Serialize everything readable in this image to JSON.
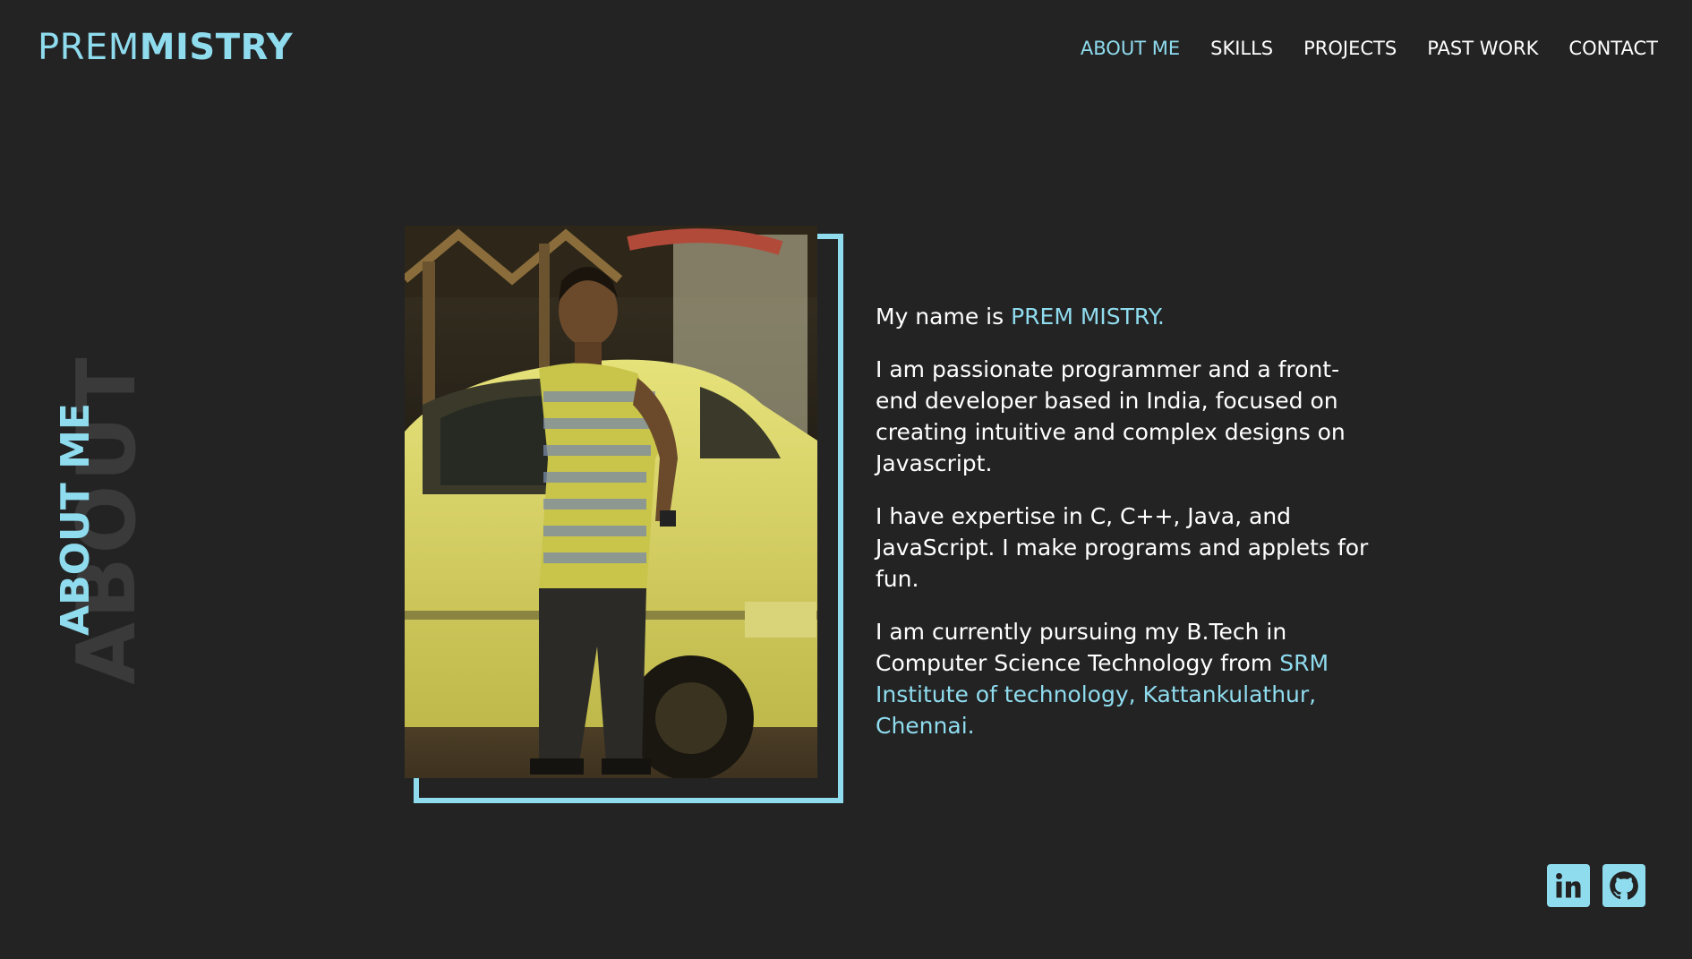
{
  "logo": {
    "first": "PREM",
    "last": "MISTRY"
  },
  "nav": {
    "items": [
      {
        "label": "ABOUT ME",
        "active": true
      },
      {
        "label": "SKILLS"
      },
      {
        "label": "PROJECTS"
      },
      {
        "label": "PAST WORK"
      },
      {
        "label": "CONTACT"
      }
    ]
  },
  "section": {
    "title_bg": "ABOUT",
    "title_fg": "ABOUT ME"
  },
  "about": {
    "name_prefix": "My name is ",
    "name": "PREM MISTRY.",
    "p2": "I am passionate programmer and a front-end developer based in India, focused on creating intuitive and complex designs on Javascript.",
    "p3": "I have expertise in C, C++, Java, and JavaScript. I make programs and applets for fun.",
    "p4_prefix": "I am currently pursuing my B.Tech in Computer Science Technology from ",
    "p4_school": "SRM Institute of technology, Kattankulathur, Chennai."
  },
  "social": {
    "linkedin_icon": "linkedin-icon",
    "github_icon": "github-icon"
  },
  "colors": {
    "accent": "#8fdcef",
    "background": "#232323"
  }
}
